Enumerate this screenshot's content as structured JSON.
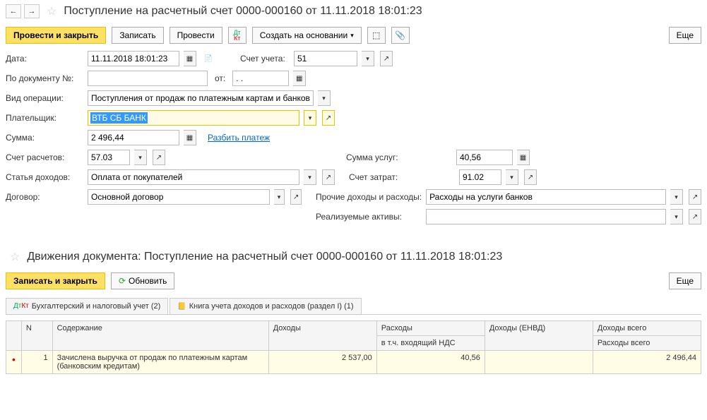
{
  "header": {
    "title": "Поступление на расчетный счет 0000-000160 от 11.11.2018 18:01:23"
  },
  "toolbar": {
    "post_close": "Провести и закрыть",
    "save": "Записать",
    "post": "Провести",
    "create_based": "Создать на основании",
    "more": "Еще"
  },
  "form": {
    "date_label": "Дата:",
    "date_value": "11.11.2018 18:01:23",
    "account_label": "Счет учета:",
    "account_value": "51",
    "docnum_label": "По документу №:",
    "docnum_value": "",
    "from_label": "от:",
    "from_value": ". .",
    "optype_label": "Вид операции:",
    "optype_value": "Поступления от продаж по платежным картам и банковским кре",
    "payer_label": "Плательщик:",
    "payer_value": "ВТБ СБ БАНК",
    "sum_label": "Сумма:",
    "sum_value": "2 496,44",
    "split_link": "Разбить платеж",
    "settle_label": "Счет расчетов:",
    "settle_value": "57.03",
    "service_sum_label": "Сумма услуг:",
    "service_sum_value": "40,56",
    "income_label": "Статья доходов:",
    "income_value": "Оплата от покупателей",
    "cost_acc_label": "Счет затрат:",
    "cost_acc_value": "91.02",
    "contract_label": "Договор:",
    "contract_value": "Основной договор",
    "other_label": "Прочие доходы и расходы:",
    "other_value": "Расходы на услуги банков",
    "assets_label": "Реализуемые активы:",
    "assets_value": ""
  },
  "movements": {
    "title": "Движения документа: Поступление на расчетный счет 0000-000160 от 11.11.2018 18:01:23",
    "save_close": "Записать и закрыть",
    "refresh": "Обновить",
    "more": "Еще",
    "tab1": "Бухгалтерский и налоговый учет (2)",
    "tab2": "Книга учета доходов и расходов (раздел I) (1)"
  },
  "table": {
    "h_n": "N",
    "h_desc": "Содержание",
    "h_income": "Доходы",
    "h_expense": "Расходы",
    "h_envd": "Доходы (ЕНВД)",
    "h_total": "Доходы всего",
    "h_vat": "в т.ч. входящий НДС",
    "h_exp_total": "Расходы всего",
    "row": {
      "n": "1",
      "desc": "Зачислена выручка от продаж по платежным картам (банковским кредитам)",
      "income": "2 537,00",
      "expense": "40,56",
      "envd": "",
      "total": "2 496,44"
    }
  }
}
